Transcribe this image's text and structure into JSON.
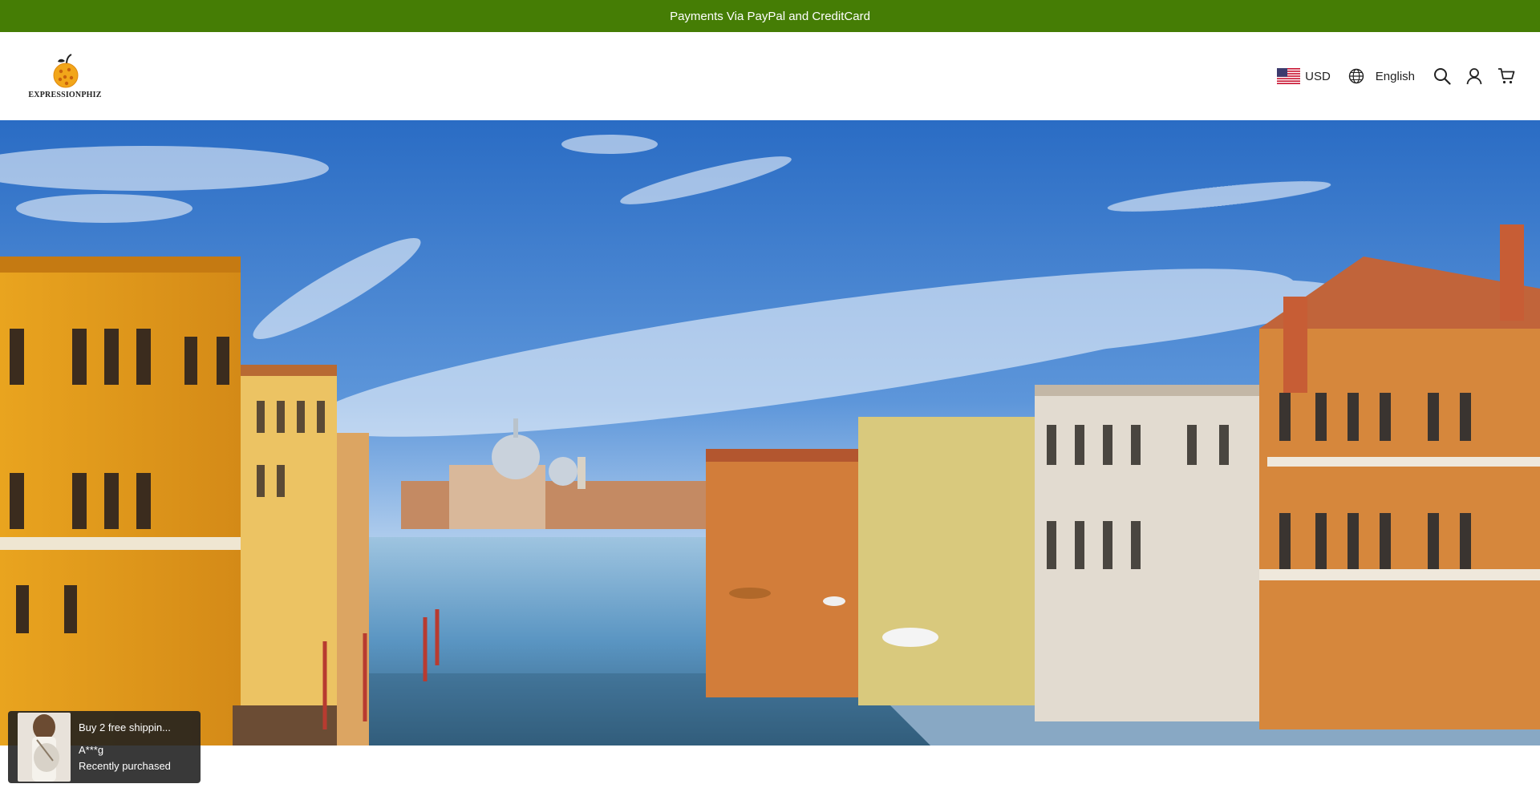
{
  "colors": {
    "announcement_bg": "#457d05",
    "announcement_text": "#ffffff",
    "header_bg": "#ffffff",
    "sky_top": "#2e6fc4",
    "water": "#5a95c2"
  },
  "announcement": {
    "text": "Payments Via PayPal and CreditCard"
  },
  "brand": {
    "name": "EXPRESSIONPHIZ",
    "icon": "orange-fruit-logo-icon"
  },
  "header": {
    "currency": {
      "code": "USD",
      "flag_icon": "us-flag-icon"
    },
    "language": {
      "label": "English",
      "icon": "globe-icon"
    },
    "icons": [
      "search-icon",
      "account-icon",
      "cart-icon"
    ]
  },
  "hero": {
    "image_subject": "venice-grand-canal-banner"
  },
  "purchase_toast": {
    "title": "Buy 2 free shippin...",
    "buyer": "A***g",
    "status": "Recently purchased"
  }
}
